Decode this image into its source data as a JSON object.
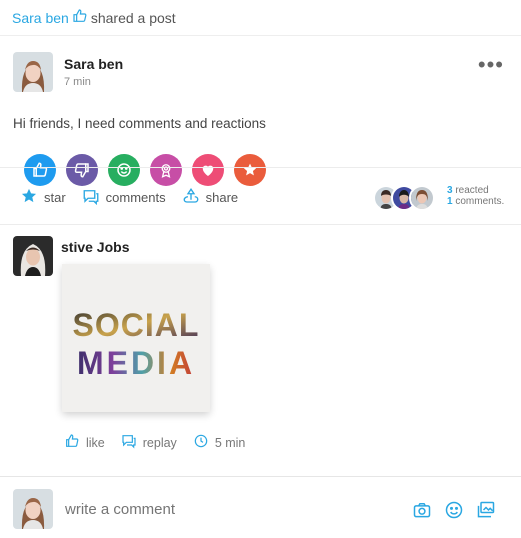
{
  "share_header": {
    "user": "Sara ben",
    "action": "shared a post"
  },
  "post": {
    "author": "Sara ben",
    "time": "7 min",
    "text": "Hi friends, I need comments and reactions",
    "more_icon": "more-dots-icon",
    "reactions": [
      {
        "name": "like-reaction-icon",
        "color": "#1e9bef"
      },
      {
        "name": "dislike-reaction-icon",
        "color": "#6b5aa7"
      },
      {
        "name": "smile-reaction-icon",
        "color": "#27ae60"
      },
      {
        "name": "award-reaction-icon",
        "color": "#c74ea6"
      },
      {
        "name": "heart-reaction-icon",
        "color": "#ee4d76"
      },
      {
        "name": "star-reaction-icon",
        "color": "#ea5c3c"
      }
    ],
    "actions": {
      "star": "star",
      "comments": "comments",
      "share": "share"
    },
    "reacted_count": "3",
    "reacted_label": "reacted",
    "comments_count": "1",
    "comments_label": "comments."
  },
  "comment": {
    "author": "stive Jobs",
    "image_text_line1": "SOCIAL",
    "image_text_line2": "MEDIA",
    "actions": {
      "like": "like",
      "replay": "replay",
      "time": "5 min"
    }
  },
  "composer": {
    "placeholder": "write a comment"
  },
  "colors": {
    "accent": "#2aa7e2"
  }
}
